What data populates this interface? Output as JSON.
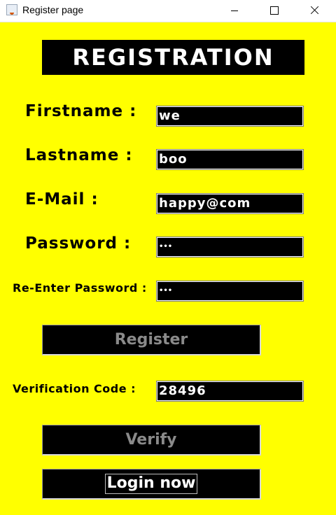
{
  "window": {
    "title": "Register page",
    "icon": "java-cup-icon"
  },
  "form": {
    "heading": "REGISTRATION",
    "firstname": {
      "label": "Firstname :",
      "value": "we"
    },
    "lastname": {
      "label": "Lastname :",
      "value": "boo"
    },
    "email": {
      "label": "E-Mail :",
      "value": "happy@com"
    },
    "password": {
      "label": "Password :",
      "masked_value": "•••"
    },
    "reenter_password": {
      "label": "Re-Enter Password :",
      "masked_value": "•••"
    },
    "register_button": "Register",
    "verification": {
      "label": "Verification Code :",
      "value": "28496"
    },
    "verify_button": "Verify",
    "login_button": "Login now"
  },
  "colors": {
    "background": "#ffff00",
    "field_background": "#000000",
    "field_text": "#ffffff",
    "disabled_button_text": "#8a8a8a"
  }
}
